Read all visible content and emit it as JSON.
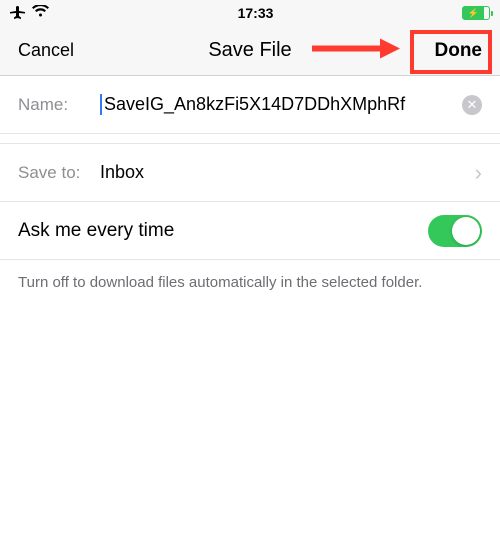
{
  "status": {
    "time": "17:33"
  },
  "nav": {
    "cancel": "Cancel",
    "title": "Save File",
    "done": "Done"
  },
  "name": {
    "label": "Name:",
    "value": "SaveIG_An8kzFi5X14D7DDhXMphRf"
  },
  "saveTo": {
    "label": "Save to:",
    "value": "Inbox"
  },
  "toggle": {
    "label": "Ask me every time",
    "on": true
  },
  "footer": "Turn off to download files automatically in the selected folder."
}
